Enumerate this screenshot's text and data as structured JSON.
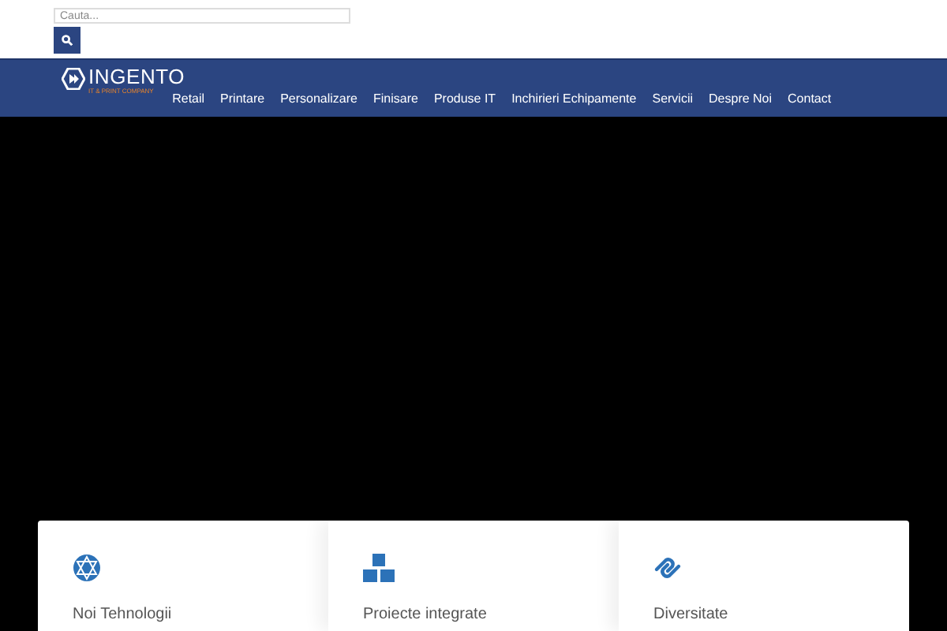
{
  "search": {
    "placeholder": "Cauta..."
  },
  "logo": {
    "name": "INGENTO",
    "tagline": "IT & PRINT COMPANY"
  },
  "nav": [
    {
      "label": "Retail"
    },
    {
      "label": "Printare"
    },
    {
      "label": "Personalizare"
    },
    {
      "label": "Finisare"
    },
    {
      "label": "Produse IT"
    },
    {
      "label": "Inchirieri Echipamente"
    },
    {
      "label": "Servicii"
    },
    {
      "label": "Despre Noi"
    },
    {
      "label": "Contact"
    }
  ],
  "features": [
    {
      "kind": "tech",
      "title": "Noi Tehnologii"
    },
    {
      "kind": "boxes",
      "title": "Proiecte integrate"
    },
    {
      "kind": "links",
      "title": "Diversitate"
    }
  ]
}
